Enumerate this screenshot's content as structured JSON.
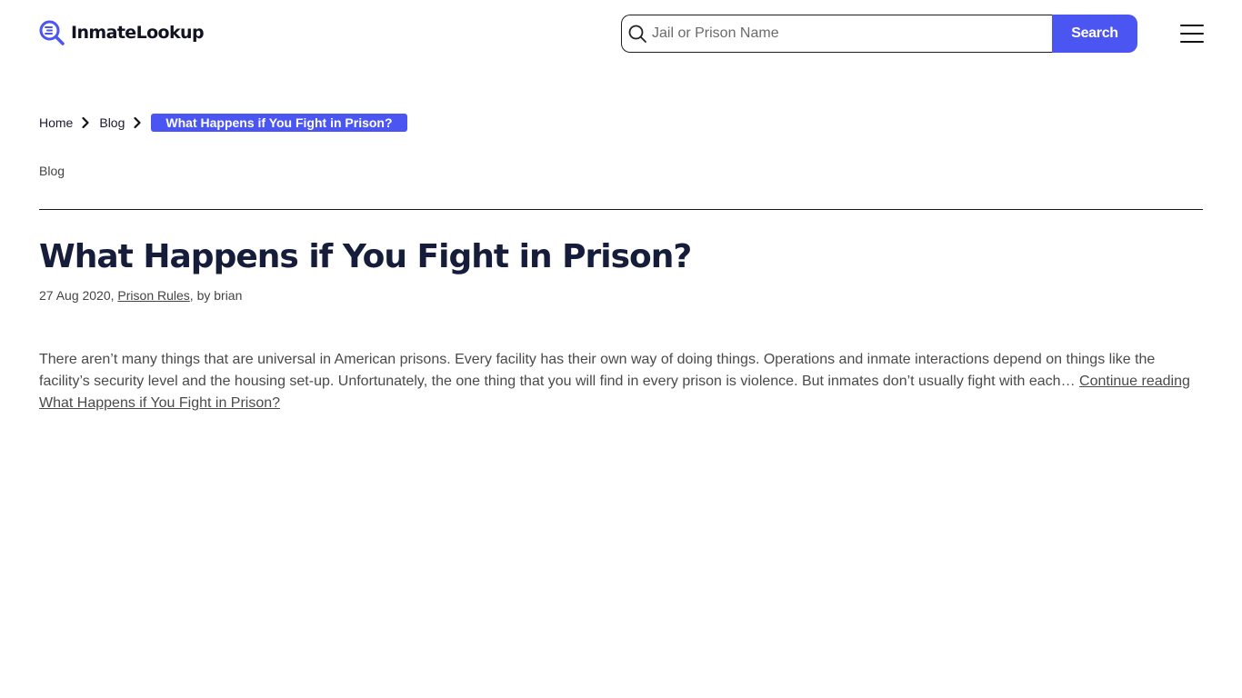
{
  "header": {
    "logo_text": "InmateLookup",
    "search": {
      "placeholder": "Jail or Prison Name",
      "value": "",
      "button_label": "Search"
    }
  },
  "breadcrumb": {
    "items": [
      {
        "label": "Home"
      },
      {
        "label": "Blog"
      }
    ],
    "current": "What Happens if You Fight in Prison?"
  },
  "category_label": "Blog",
  "post": {
    "title": "What Happens if You Fight in Prison?",
    "date": "27 Aug 2020,",
    "category_link": "Prison Rules",
    "author_text": ", by brian",
    "excerpt": "There aren’t many things that are universal in American prisons. Every facility has their own way of doing things. Operations and inmate interactions depend on things like the facility’s security level and the housing set-up. Unfortunately, the one thing that you will find in every prison is violence. But inmates don’t usually fight with each… ",
    "read_more": "Continue reading What Happens if You Fight in Prison?"
  },
  "colors": {
    "accent": "#4b56f2",
    "title": "#161d3b",
    "text": "#4a4a4a"
  },
  "icons": {
    "logo": "magnifier-logo-icon",
    "search": "search-icon",
    "menu": "hamburger-menu-icon",
    "separator": "chevron-right-icon"
  }
}
